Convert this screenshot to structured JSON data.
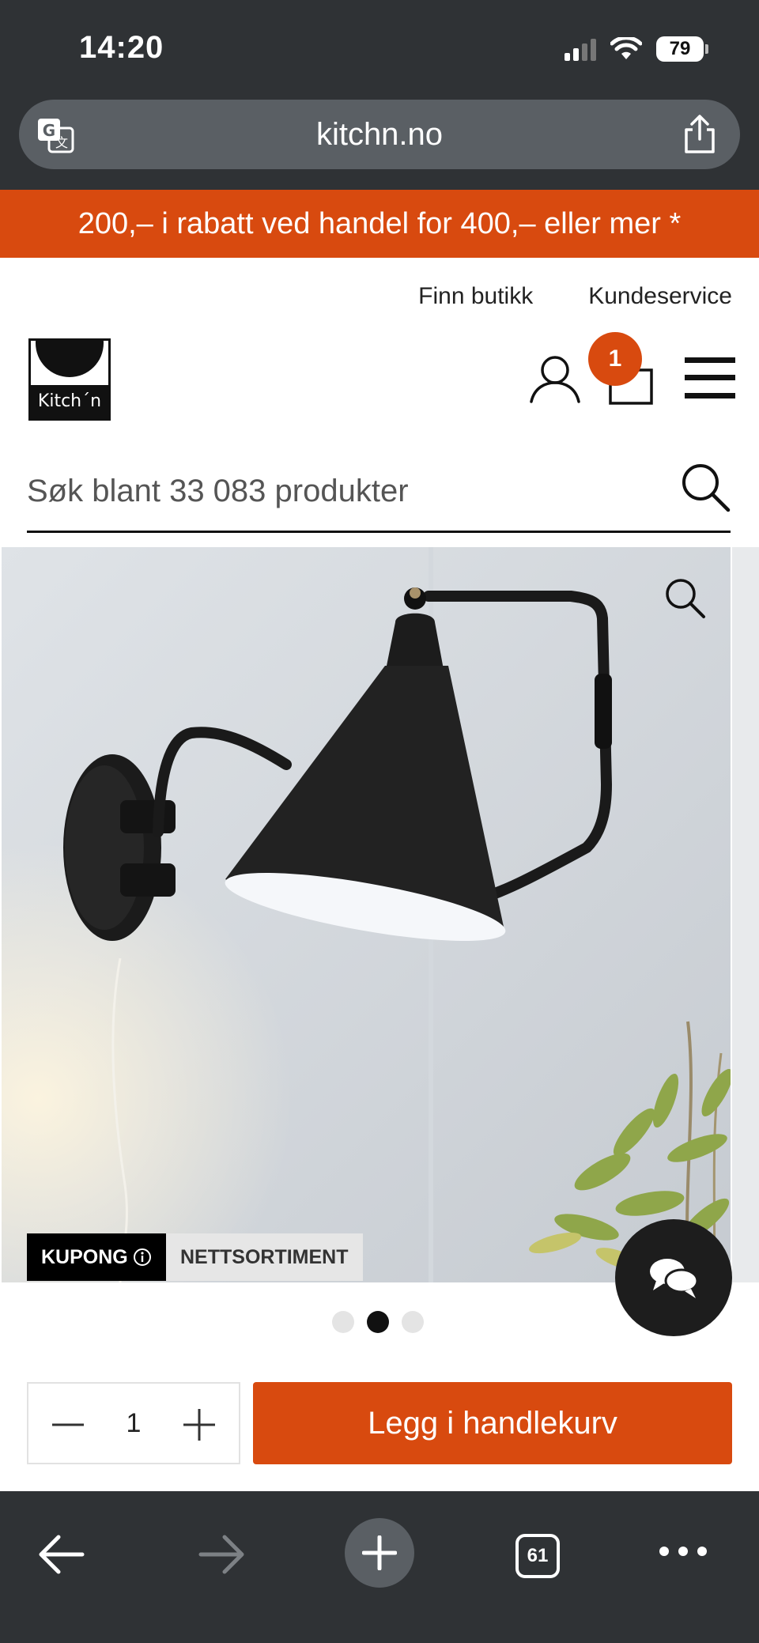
{
  "status_bar": {
    "time": "14:20",
    "battery": "79"
  },
  "browser": {
    "url": "kitchn.no",
    "tab_count": "61"
  },
  "promo": {
    "text": "200,– i rabatt ved handel for 400,– eller mer *"
  },
  "header": {
    "util_links": [
      "Finn butikk",
      "Kundeservice"
    ],
    "logo_text": "Kitch´n",
    "cart_count": "1"
  },
  "search": {
    "placeholder": "Søk blant 33 083 produkter"
  },
  "product": {
    "badges": {
      "coupon": "KUPONG",
      "web_only": "NETTSORTIMENT"
    },
    "gallery": {
      "total_images": 3,
      "active_index": 1
    }
  },
  "purchase": {
    "quantity": "1",
    "add_to_cart_label": "Legg i handlekurv"
  },
  "colors": {
    "accent": "#d84a0f",
    "chrome": "#2f3235",
    "url_bar": "#5a5f64"
  }
}
